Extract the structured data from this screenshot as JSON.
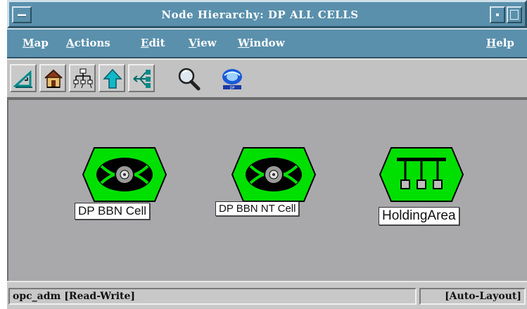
{
  "window": {
    "title": "Node Hierarchy: DP ALL CELLS"
  },
  "menubar": {
    "items": [
      "Map",
      "Actions",
      "Edit",
      "View",
      "Window"
    ],
    "help": "Help"
  },
  "toolbar": {
    "tools": [
      {
        "icon": "triangle-ruler-icon"
      },
      {
        "icon": "home-icon"
      },
      {
        "icon": "hierarchy-icon"
      },
      {
        "icon": "up-arrow-icon"
      },
      {
        "icon": "network-branch-icon"
      },
      {
        "icon": "magnifier-icon"
      },
      {
        "icon": "data-protector-logo-icon"
      }
    ],
    "logo_caption": "DP"
  },
  "nodes": [
    {
      "label": "DP BBN Cell",
      "type": "cell",
      "color": "#00e000"
    },
    {
      "label": "DP BBN NT Cell",
      "type": "cell",
      "color": "#00e000"
    },
    {
      "label": "HoldingArea",
      "type": "holding-area",
      "color": "#00e000"
    }
  ],
  "status": {
    "user": "opc_adm [Read-Write]",
    "layout": "[Auto-Layout]"
  },
  "colors": {
    "titlebar": "#5a90ac",
    "node_fill": "#00e000",
    "canvas": "#a9a9ac"
  }
}
